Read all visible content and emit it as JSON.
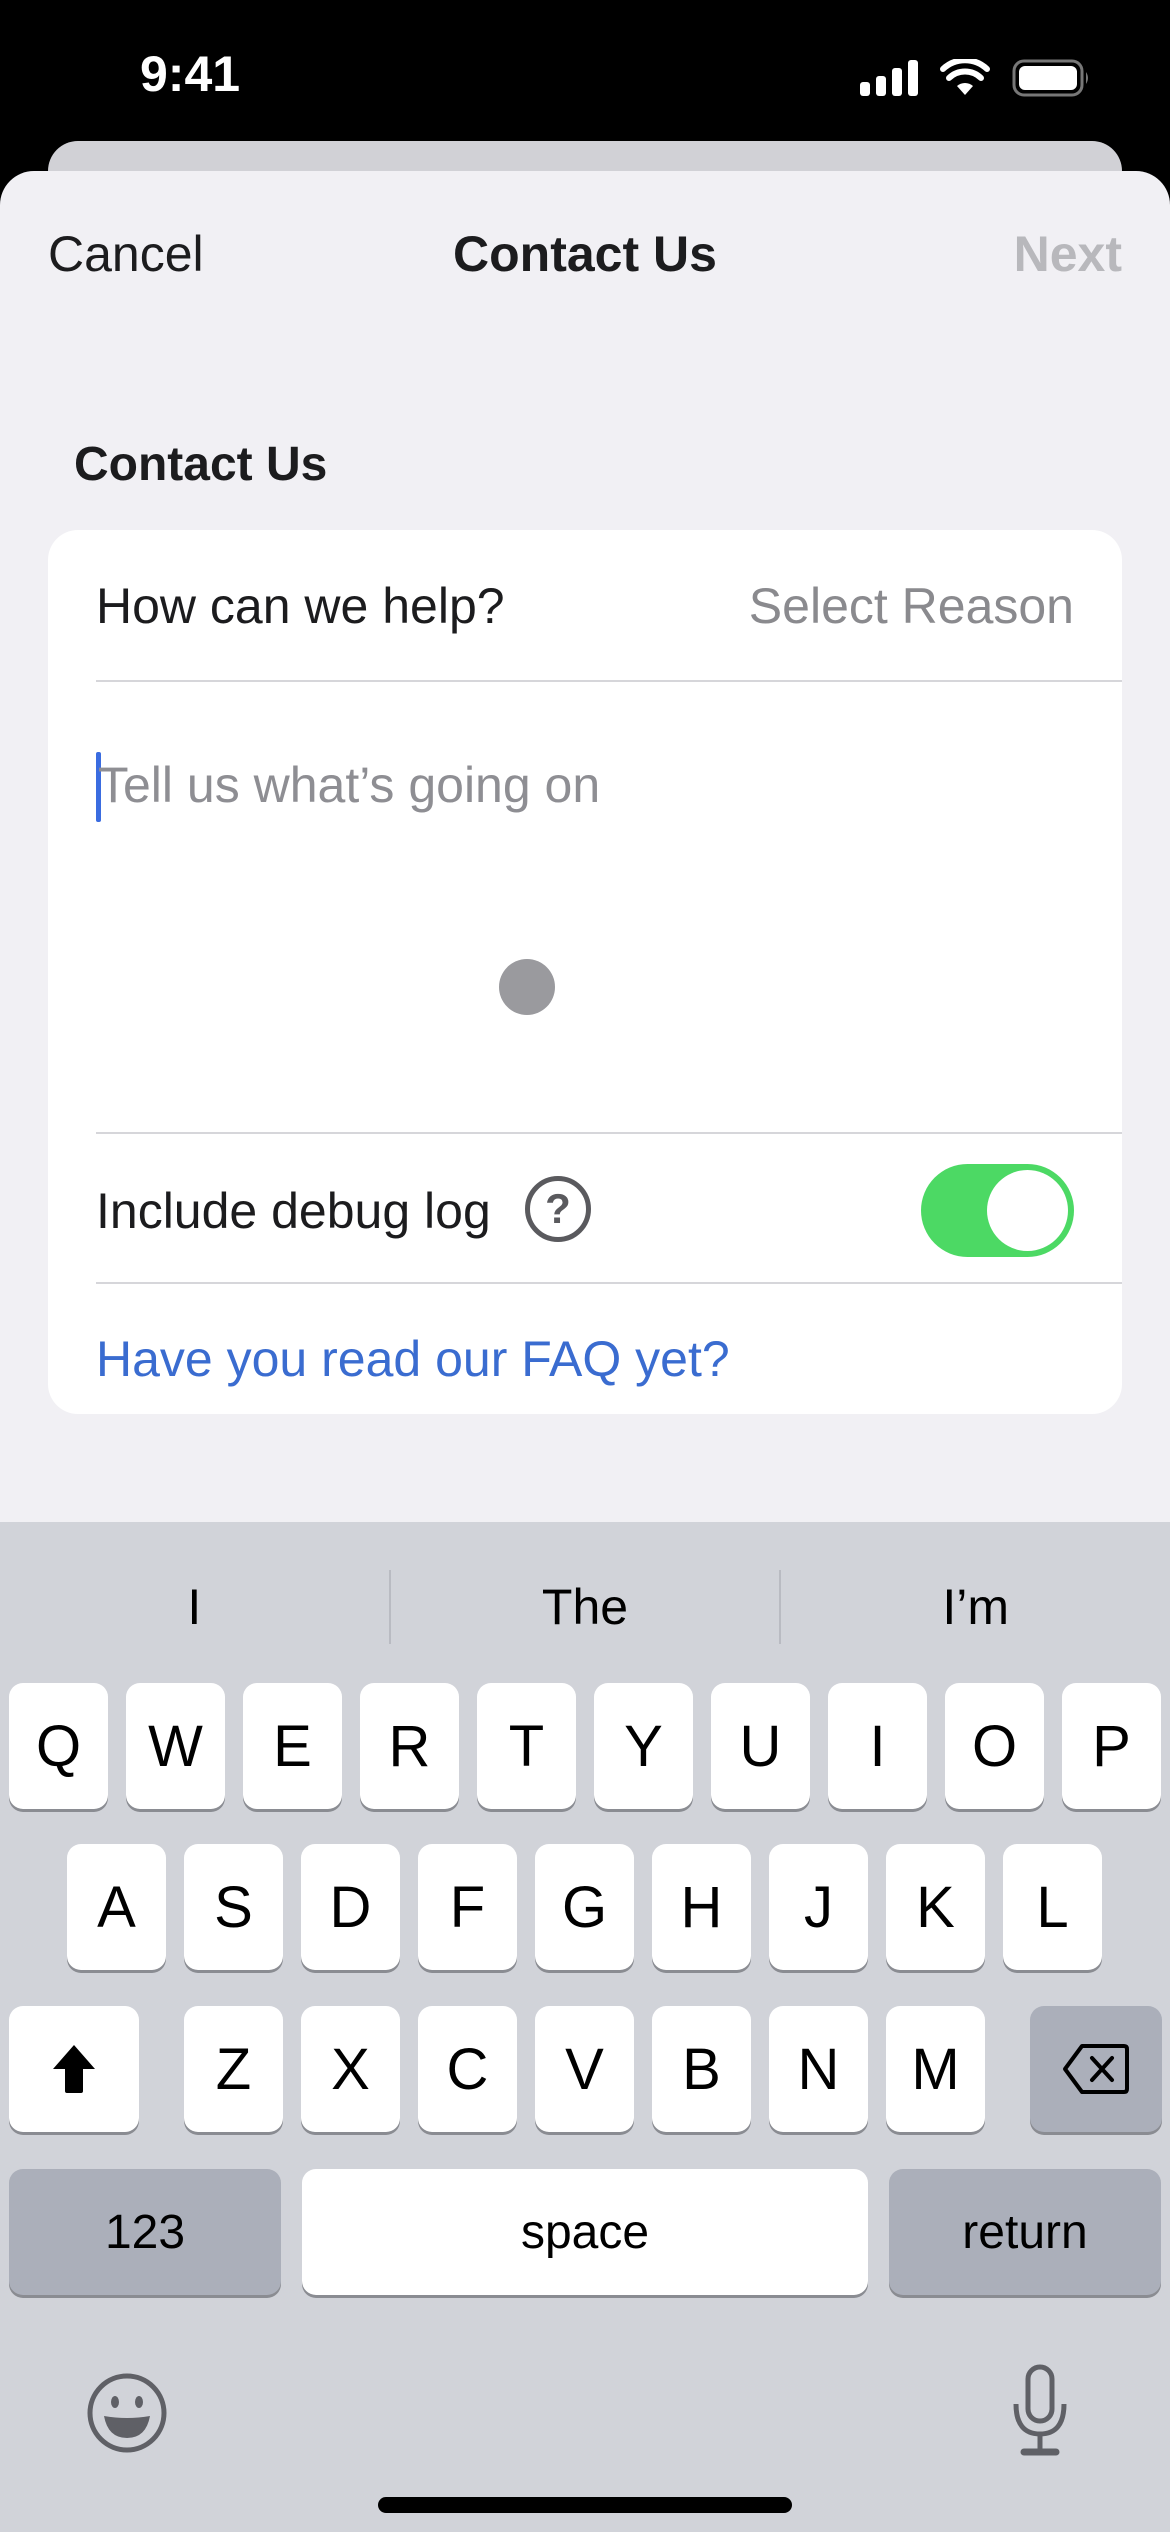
{
  "status_bar": {
    "time": "9:41",
    "icons": [
      "cellular-signal-icon",
      "wifi-icon",
      "battery-icon"
    ]
  },
  "nav": {
    "cancel_label": "Cancel",
    "title": "Contact Us",
    "next_label": "Next",
    "next_enabled": false
  },
  "form": {
    "section_header": "Contact Us",
    "reason": {
      "label": "How can we help?",
      "value": "Select Reason"
    },
    "message": {
      "value": "",
      "placeholder": "Tell us what’s going on"
    },
    "debug_log": {
      "label": "Include debug log",
      "help_icon": "question-circle-icon",
      "help_glyph": "?",
      "enabled": true
    },
    "faq_link": "Have you read our FAQ yet?"
  },
  "colors": {
    "accent_link": "#3a6cd0",
    "toggle_on": "#4cd964",
    "disabled_text": "#b8b8bc",
    "sheet_background": "#f1f0f4",
    "keyboard_background": "#d1d3d9"
  },
  "keyboard": {
    "suggestions": [
      "I",
      "The",
      "I’m"
    ],
    "row1": [
      "Q",
      "W",
      "E",
      "R",
      "T",
      "Y",
      "U",
      "I",
      "O",
      "P"
    ],
    "row2": [
      "A",
      "S",
      "D",
      "F",
      "G",
      "H",
      "J",
      "K",
      "L"
    ],
    "row3": [
      "Z",
      "X",
      "C",
      "V",
      "B",
      "N",
      "M"
    ],
    "shift_icon": "shift-arrow-icon",
    "delete_icon": "delete-backspace-icon",
    "numbers_label": "123",
    "space_label": "space",
    "return_label": "return",
    "emoji_icon": "emoji-icon",
    "dictation_icon": "microphone-icon"
  }
}
